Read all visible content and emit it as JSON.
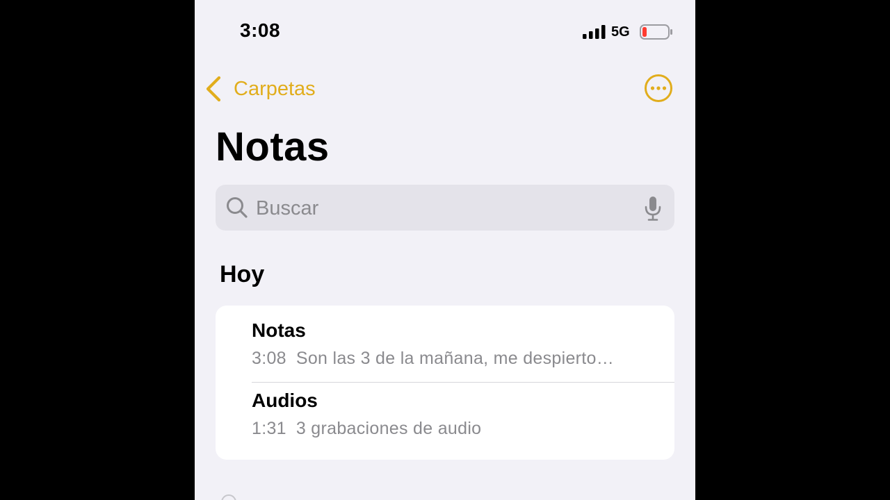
{
  "status_bar": {
    "time": "3:08",
    "network": "5G",
    "battery_color": "#ff3b30"
  },
  "nav": {
    "back_label": "Carpetas",
    "accent_color": "#e1ad1c",
    "back_icon": "chevron-left-icon",
    "more_icon": "ellipsis-circle-icon"
  },
  "page": {
    "title": "Notas"
  },
  "search": {
    "placeholder": "Buscar",
    "value": "",
    "icon": "search-icon",
    "mic_icon": "microphone-icon"
  },
  "sections": [
    {
      "header": "Hoy",
      "items": [
        {
          "title": "Notas",
          "time": "3:08",
          "preview": "Son las 3 de la mañana, me despierto…"
        },
        {
          "title": "Audios",
          "time": "1:31",
          "preview": "3 grabaciones de audio"
        }
      ]
    }
  ]
}
